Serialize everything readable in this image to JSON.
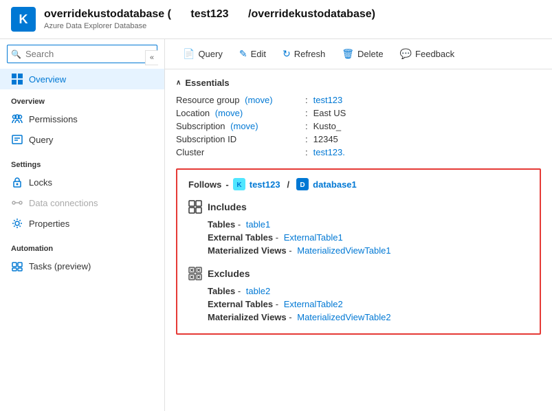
{
  "header": {
    "title": "overridekustodatabase (     test123     /overridekustodatabase)",
    "title_main": "overridekustodatabase (",
    "title_sub_cluster": "test123",
    "title_end": "/overridekustodatabase)",
    "subtitle": "Azure Data Explorer Database"
  },
  "search": {
    "placeholder": "Search"
  },
  "toolbar": {
    "query_label": "Query",
    "edit_label": "Edit",
    "refresh_label": "Refresh",
    "delete_label": "Delete",
    "feedback_label": "Feedback"
  },
  "sidebar": {
    "overview_label": "Overview",
    "sections": [
      {
        "label": "Overview",
        "items": [
          {
            "id": "overview",
            "label": "Overview",
            "icon": "overview-icon",
            "active": true
          },
          {
            "id": "permissions",
            "label": "Permissions",
            "icon": "permissions-icon"
          },
          {
            "id": "query",
            "label": "Query",
            "icon": "query-icon"
          }
        ]
      },
      {
        "label": "Settings",
        "items": [
          {
            "id": "locks",
            "label": "Locks",
            "icon": "lock-icon"
          },
          {
            "id": "data-connections",
            "label": "Data connections",
            "icon": "data-connections-icon",
            "disabled": true
          },
          {
            "id": "properties",
            "label": "Properties",
            "icon": "properties-icon"
          }
        ]
      },
      {
        "label": "Automation",
        "items": [
          {
            "id": "tasks",
            "label": "Tasks (preview)",
            "icon": "tasks-icon"
          }
        ]
      }
    ]
  },
  "essentials": {
    "section_label": "Essentials",
    "rows": [
      {
        "label": "Resource group",
        "has_move": true,
        "colon": ":",
        "value": "test123",
        "value_is_link": true
      },
      {
        "label": "Location",
        "has_move": true,
        "colon": ":",
        "value": "East US",
        "value_is_link": false
      },
      {
        "label": "Subscription",
        "has_move": true,
        "colon": ":",
        "value": "Kusto_",
        "value_is_link": false
      },
      {
        "label": "Subscription ID",
        "has_move": false,
        "colon": ":",
        "value": "12345",
        "value_is_link": false
      },
      {
        "label": "Cluster",
        "has_move": false,
        "colon": ":",
        "value": "test123.",
        "value_is_link": true
      }
    ]
  },
  "follows": {
    "label": "Follows",
    "cluster_name": "test123",
    "slash": "/",
    "database_name": "database1",
    "includes": {
      "header": "Includes",
      "rows": [
        {
          "label": "Tables",
          "separator": "-",
          "value": "table1"
        },
        {
          "label": "External Tables",
          "separator": "-",
          "value": "ExternalTable1"
        },
        {
          "label": "Materialized Views",
          "separator": "-",
          "value": "MaterializedViewTable1"
        }
      ]
    },
    "excludes": {
      "header": "Excludes",
      "rows": [
        {
          "label": "Tables",
          "separator": "-",
          "value": "table2"
        },
        {
          "label": "External Tables",
          "separator": "-",
          "value": "ExternalTable2"
        },
        {
          "label": "Materialized Views",
          "separator": "-",
          "value": "MaterializedViewTable2"
        }
      ]
    }
  },
  "colors": {
    "accent": "#0078d4",
    "border_red": "#e53935",
    "text_link": "#0078d4"
  }
}
